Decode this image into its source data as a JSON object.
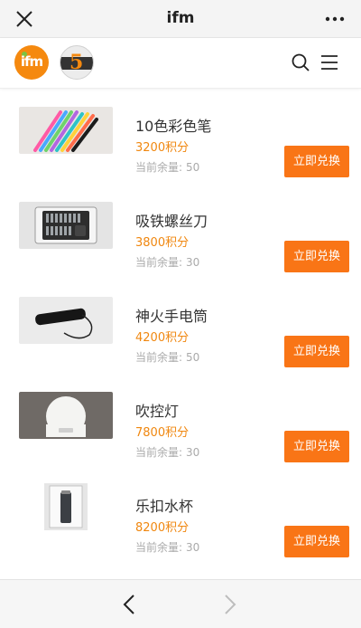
{
  "window": {
    "title": "ifm"
  },
  "header": {
    "logo_text": "ifm",
    "badge_number": "5"
  },
  "products": [
    {
      "name": "10色彩色笔",
      "points": "3200积分",
      "stock_label": "当前余量:",
      "stock_value": "50",
      "button": "立即兑换"
    },
    {
      "name": "吸铁螺丝刀",
      "points": "3800积分",
      "stock_label": "当前余量:",
      "stock_value": "30",
      "button": "立即兑换"
    },
    {
      "name": "神火手电筒",
      "points": "4200积分",
      "stock_label": "当前余量:",
      "stock_value": "50",
      "button": "立即兑换"
    },
    {
      "name": "吹控灯",
      "points": "7800积分",
      "stock_label": "当前余量:",
      "stock_value": "30",
      "button": "立即兑换"
    },
    {
      "name": "乐扣水杯",
      "points": "8200积分",
      "stock_label": "当前余量:",
      "stock_value": "30",
      "button": "立即兑换"
    }
  ],
  "icons": {
    "close": "close-icon",
    "more": "more-icon",
    "search": "search-icon",
    "menu": "menu-icon",
    "back": "chevron-left-icon",
    "forward": "chevron-right-icon"
  },
  "colors": {
    "accent": "#f97516",
    "points": "#f0870f",
    "muted": "#aaaaaa"
  }
}
